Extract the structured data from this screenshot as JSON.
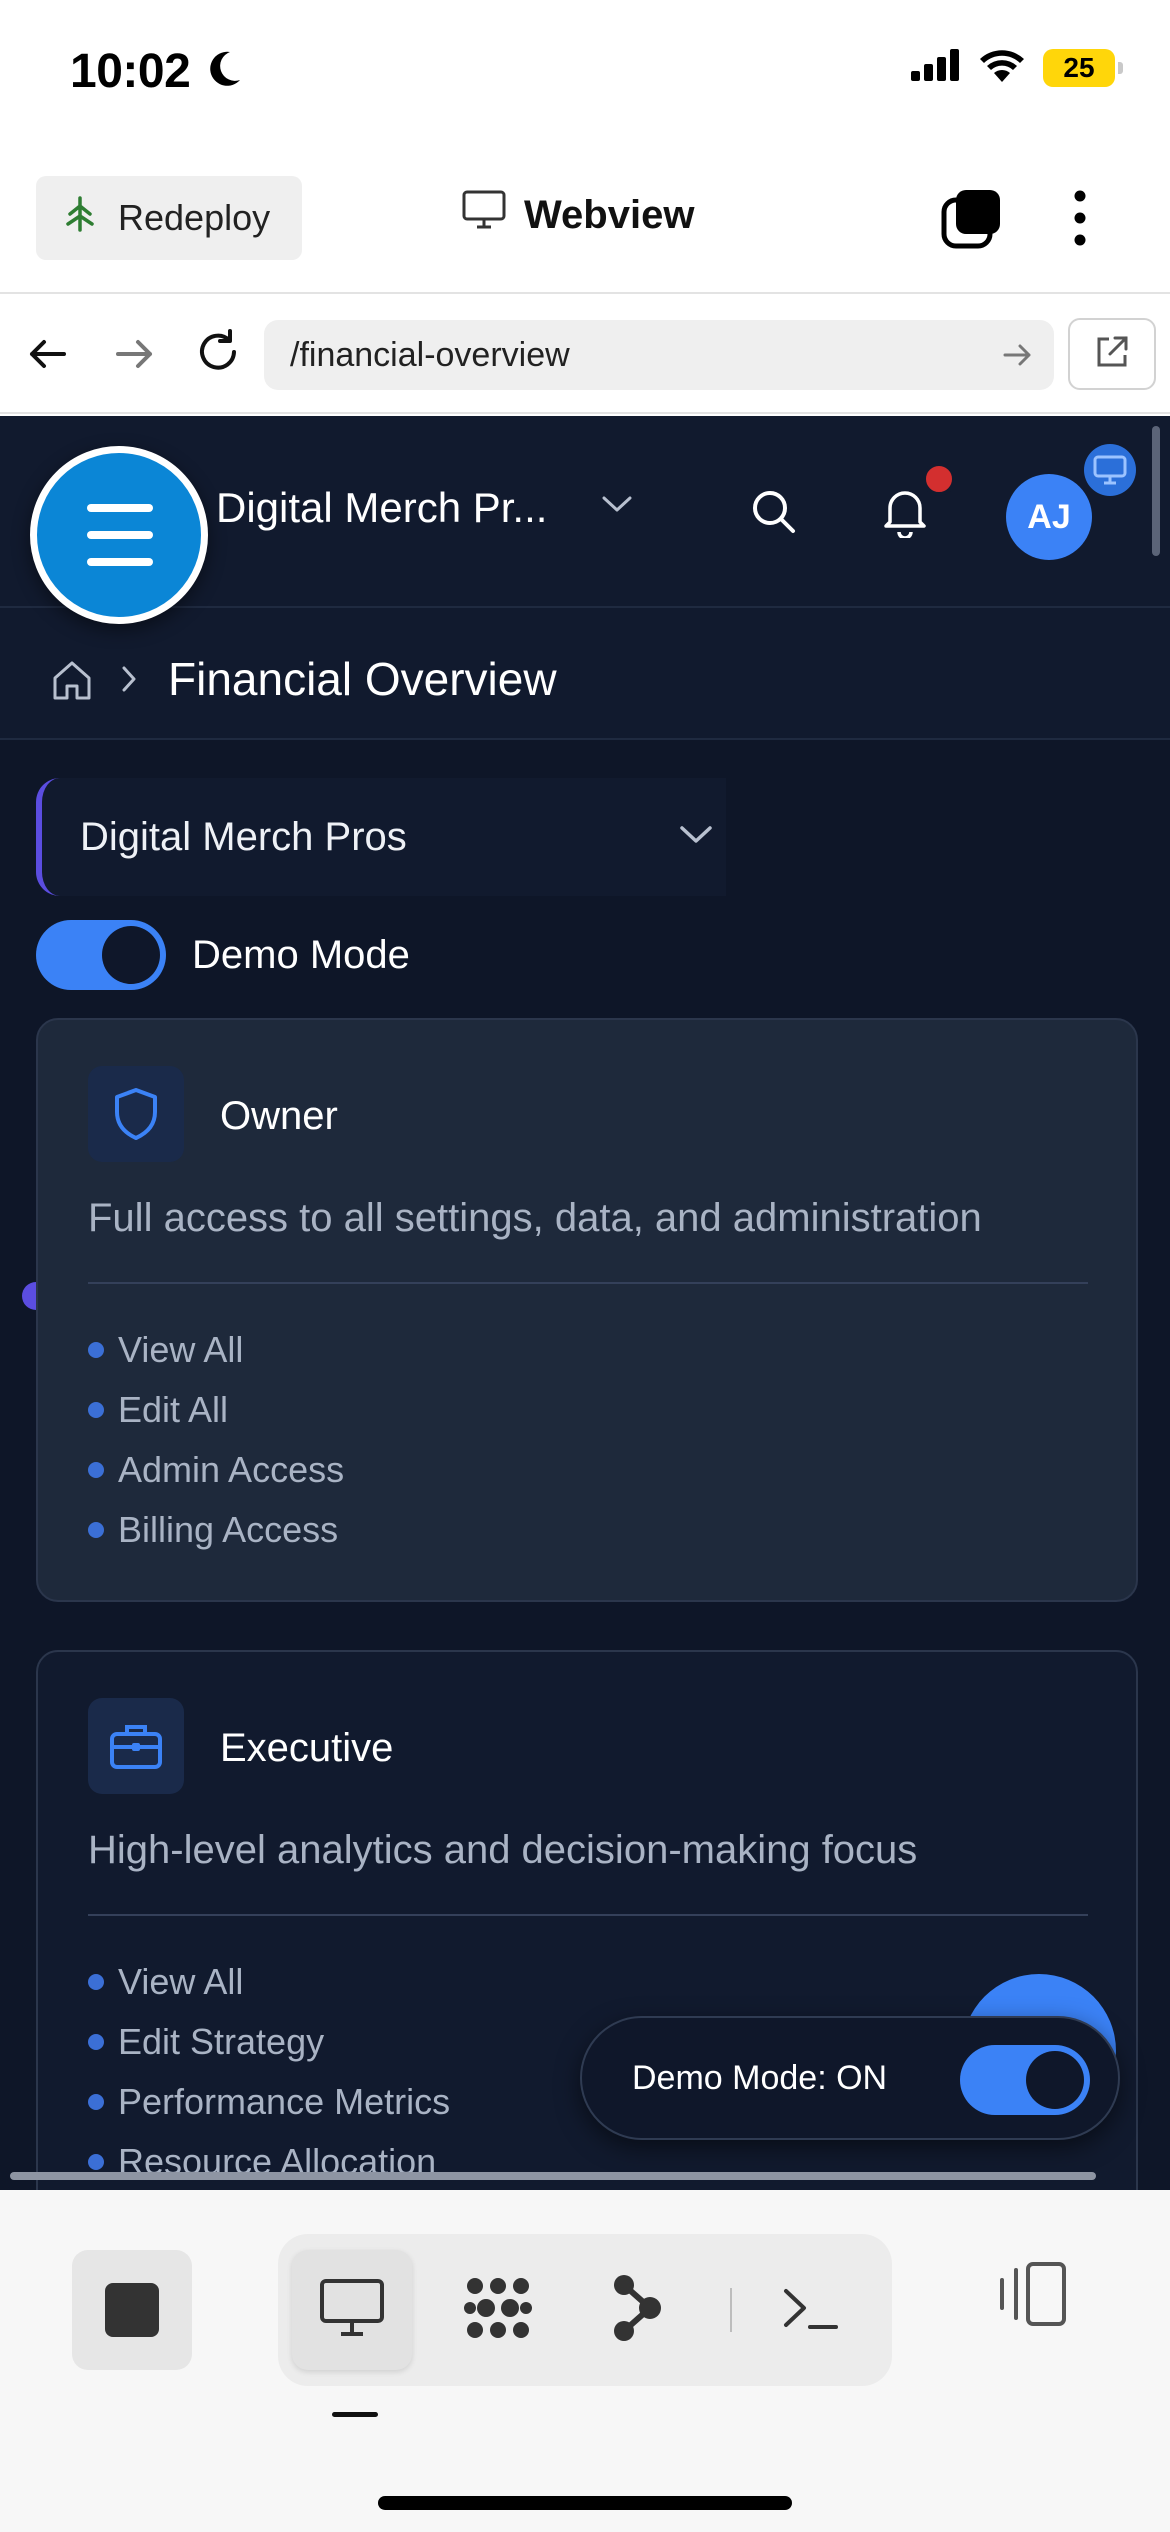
{
  "status_bar": {
    "time": "10:02",
    "battery": "25"
  },
  "app_header": {
    "redeploy_label": "Redeploy",
    "title": "Webview"
  },
  "url_bar": {
    "url": "/financial-overview"
  },
  "topbar": {
    "org_name": "Digital Merch Pr...",
    "avatar_initials": "AJ"
  },
  "breadcrumb": {
    "title": "Financial Overview"
  },
  "org_select": {
    "value": "Digital Merch Pros"
  },
  "demo_mode": {
    "label": "Demo Mode",
    "enabled": true,
    "pill_label": "Demo Mode: ON"
  },
  "roles": [
    {
      "title": "Owner",
      "icon": "shield-icon",
      "description": "Full access to all settings, data, and administration",
      "permissions": [
        "View All",
        "Edit All",
        "Admin Access",
        "Billing Access"
      ]
    },
    {
      "title": "Executive",
      "icon": "briefcase-icon",
      "description": "High-level analytics and decision-making focus",
      "permissions": [
        "View All",
        "Edit Strategy",
        "Performance Metrics",
        "Resource Allocation"
      ]
    }
  ],
  "colors": {
    "accent": "#3b82f6",
    "fab": "#0b86d6",
    "background": "#0e1628",
    "card": "#1e293b",
    "notification": "#d32f2f"
  }
}
